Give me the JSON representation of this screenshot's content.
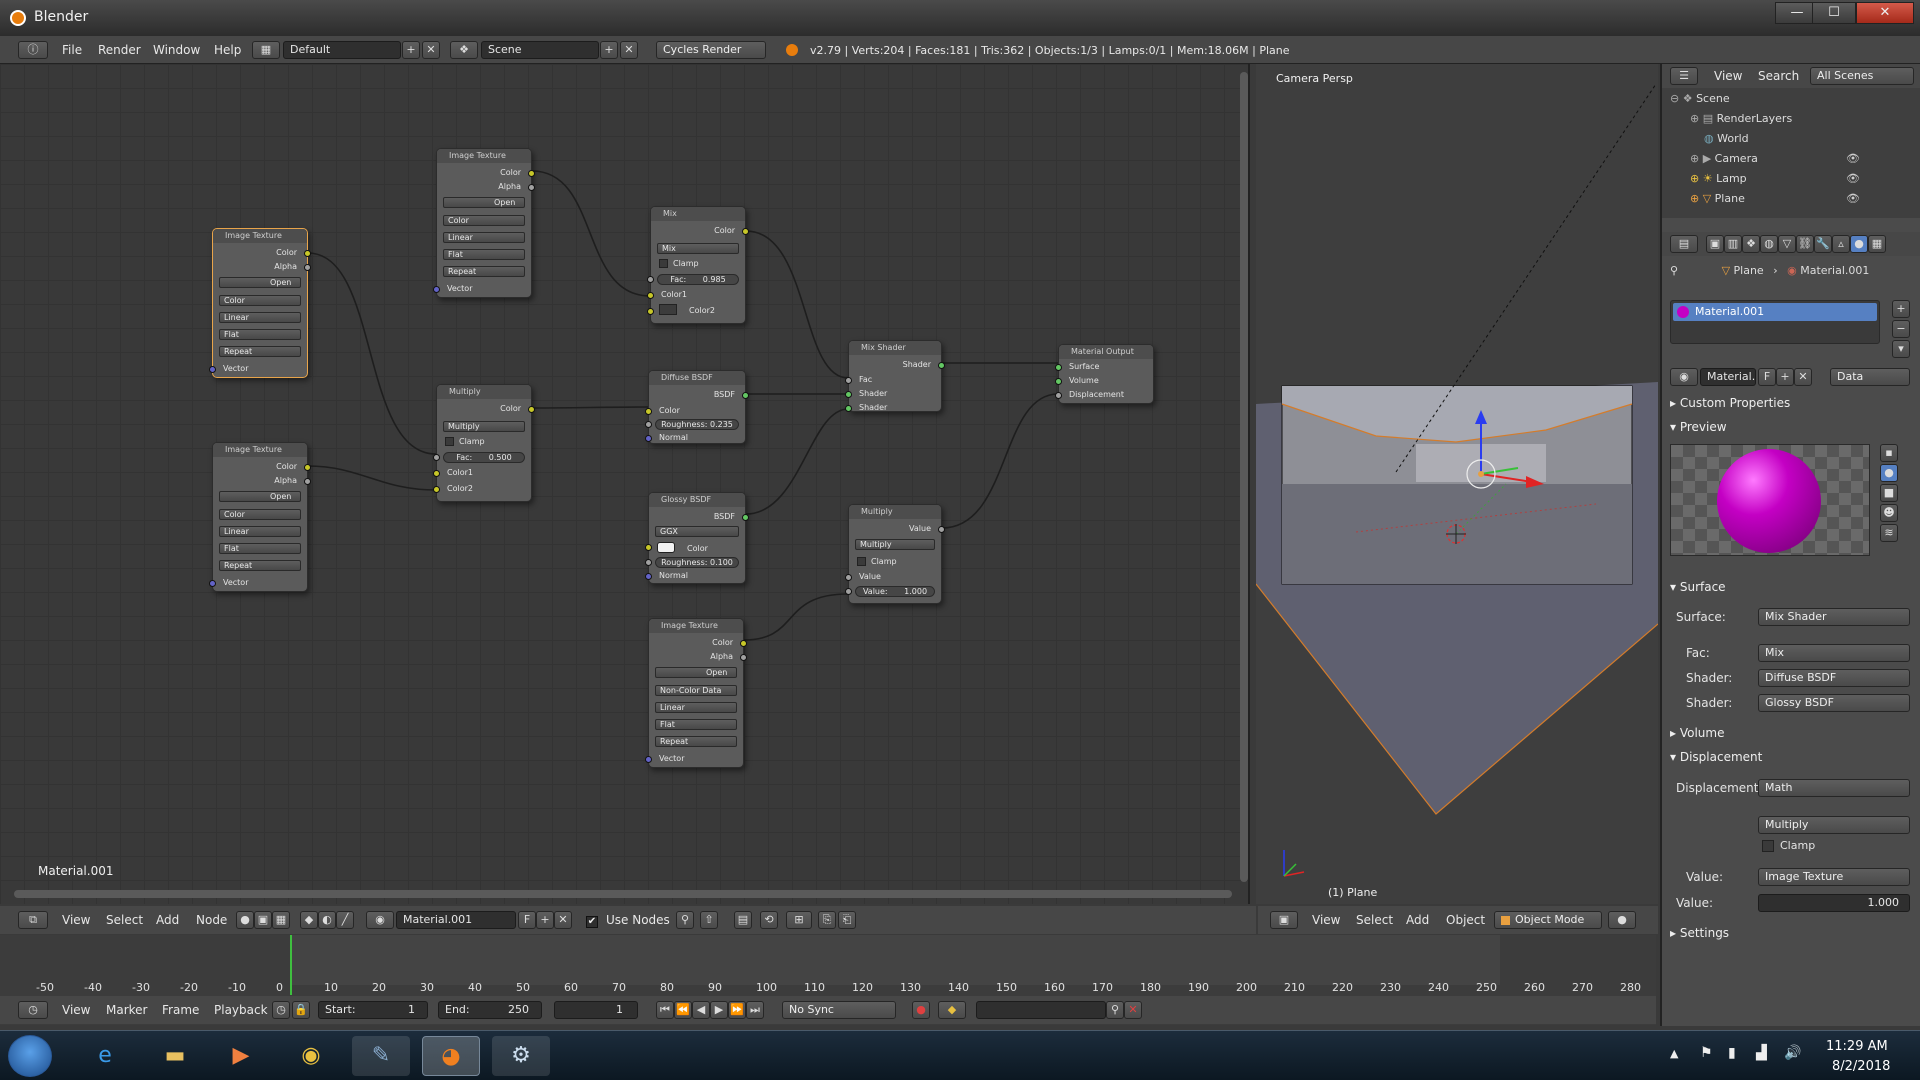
{
  "window": {
    "title": "Blender",
    "minimize": "—",
    "maximize": "☐",
    "close": "✕"
  },
  "info_header": {
    "menus": [
      "File",
      "Render",
      "Window",
      "Help"
    ],
    "screen_layout": "Default",
    "scene": "Scene",
    "render_engine": "Cycles Render",
    "stats": "v2.79 | Verts:204 | Faces:181 | Tris:362 | Objects:1/3 | Lamps:0/1 | Mem:18.06M | Plane"
  },
  "node_editor": {
    "material_label": "Material.001",
    "nodes": {
      "img1": {
        "title": "Image Texture",
        "color": "Color",
        "alpha": "Alpha",
        "open": "Open",
        "cs": "Color",
        "interp": "Linear",
        "proj": "Flat",
        "ext": "Repeat",
        "vector": "Vector"
      },
      "img2": {
        "title": "Image Texture",
        "color": "Color",
        "alpha": "Alpha",
        "open": "Open",
        "cs": "Color",
        "interp": "Linear",
        "proj": "Flat",
        "ext": "Repeat",
        "vector": "Vector"
      },
      "img3": {
        "title": "Image Texture",
        "color": "Color",
        "alpha": "Alpha",
        "open": "Open",
        "cs": "Color",
        "interp": "Linear",
        "proj": "Flat",
        "ext": "Repeat",
        "vector": "Vector"
      },
      "img4": {
        "title": "Image Texture",
        "color": "Color",
        "alpha": "Alpha",
        "open": "Open",
        "cs": "Non-Color Data",
        "interp": "Linear",
        "proj": "Flat",
        "ext": "Repeat",
        "vector": "Vector"
      },
      "multiply1": {
        "title": "Multiply",
        "color": "Color",
        "mode": "Multiply",
        "clamp": "Clamp",
        "fac": "Fac:",
        "fac_value": "0.500",
        "color1": "Color1",
        "color2": "Color2"
      },
      "mix": {
        "title": "Mix",
        "color": "Color",
        "mode": "Mix",
        "clamp": "Clamp",
        "fac": "Fac:",
        "fac_value": "0.985",
        "color1": "Color1",
        "color2": "Color2"
      },
      "diffuse": {
        "title": "Diffuse BSDF",
        "bsdf": "BSDF",
        "color": "Color",
        "roughness": "Roughness: 0.235",
        "normal": "Normal"
      },
      "glossy": {
        "title": "Glossy BSDF",
        "bsdf": "BSDF",
        "dist": "GGX",
        "color": "Color",
        "roughness": "Roughness: 0.100",
        "normal": "Normal"
      },
      "mixshader": {
        "title": "Mix Shader",
        "shader_out": "Shader",
        "fac": "Fac",
        "shader1": "Shader",
        "shader2": "Shader"
      },
      "math": {
        "title": "Multiply",
        "value_out": "Value",
        "mode": "Multiply",
        "clamp": "Clamp",
        "value_in": "Value",
        "value_field": "Value:",
        "value_num": "1.000"
      },
      "output": {
        "title": "Material Output",
        "surface": "Surface",
        "volume": "Volume",
        "displacement": "Displacement"
      }
    }
  },
  "node_header": {
    "menus": [
      "View",
      "Select",
      "Add",
      "Node"
    ],
    "material": "Material.001",
    "fake_user": "F",
    "use_nodes": "Use Nodes"
  },
  "viewport": {
    "label": "Camera Persp",
    "object_label": "(1) Plane",
    "menus": [
      "View",
      "Select",
      "Add",
      "Object"
    ],
    "mode": "Object Mode"
  },
  "outliner": {
    "menus": [
      "View",
      "Search"
    ],
    "filter": "All Scenes",
    "items": [
      "Scene",
      "RenderLayers",
      "World",
      "Camera",
      "Lamp",
      "Plane"
    ]
  },
  "properties": {
    "breadcrumb_object": "Plane",
    "breadcrumb_material": "Material.001",
    "material_slot": "Material.001",
    "material_field": "Material.",
    "fake": "F",
    "data_link": "Data",
    "sections": {
      "custom_props": "Custom Properties",
      "preview": "Preview",
      "surface": "Surface",
      "volume": "Volume",
      "displacement": "Displacement",
      "settings": "Settings"
    },
    "surface": {
      "label": "Surface:",
      "value": "Mix Shader",
      "fac_label": "Fac:",
      "fac_value": "Mix",
      "shader1_label": "Shader:",
      "shader1_value": "Diffuse BSDF",
      "shader2_label": "Shader:",
      "shader2_value": "Glossy BSDF"
    },
    "displacement": {
      "label": "Displacement:",
      "value": "Math",
      "op": "Multiply",
      "clamp": "Clamp",
      "value_label": "Value:",
      "value_value": "Image Texture",
      "value2_label": "Value:",
      "value2_value": "1.000"
    },
    "preview_color": "#c400c4"
  },
  "timeline": {
    "ticks": [
      "-50",
      "-40",
      "-30",
      "-20",
      "-10",
      "0",
      "10",
      "20",
      "30",
      "40",
      "50",
      "60",
      "70",
      "80",
      "90",
      "100",
      "110",
      "120",
      "130",
      "140",
      "150",
      "160",
      "170",
      "180",
      "190",
      "200",
      "210",
      "220",
      "230",
      "240",
      "250",
      "260",
      "270",
      "280"
    ],
    "menus": [
      "View",
      "Marker",
      "Frame",
      "Playback"
    ],
    "start_label": "Start:",
    "start_value": "1",
    "end_label": "End:",
    "end_value": "250",
    "current": "1",
    "sync": "No Sync"
  },
  "taskbar": {
    "time": "11:29 AM",
    "date": "8/2/2018"
  }
}
